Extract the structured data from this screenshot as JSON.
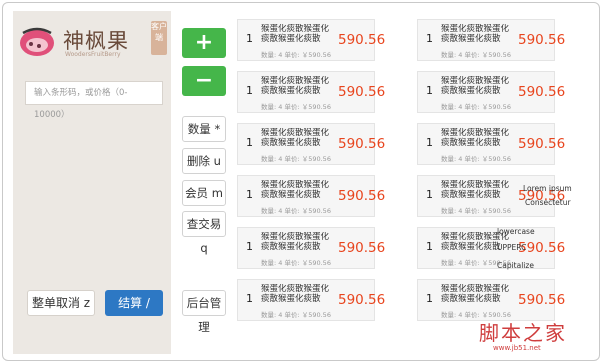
{
  "brand": {
    "name": "神枫果",
    "sub": "WoodersFruitBerry",
    "badge": "客户端"
  },
  "search": {
    "placeholder": "输入条形码，或价格（0-10000）"
  },
  "actions": {
    "plus": "+",
    "minus": "−",
    "quantity": "数量 *",
    "delete": "删除 u",
    "member": "会员 m",
    "query": "查交易 q",
    "admin": "后台管理",
    "cancel_order": "整单取消 z",
    "checkout": "结算 /"
  },
  "items": [
    {
      "qty": "1",
      "name": "猴蛋化痰散猴蛋化痰散猴蛋化痰散",
      "price": "590.56",
      "meta": "数量: 4     单价: ￥590.56"
    },
    {
      "qty": "1",
      "name": "猴蛋化痰散猴蛋化痰散猴蛋化痰散",
      "price": "590.56",
      "meta": "数量: 4     单价: ￥590.56"
    },
    {
      "qty": "1",
      "name": "猴蛋化痰散猴蛋化痰散猴蛋化痰散",
      "price": "590.56",
      "meta": "数量: 4     单价: ￥590.56"
    },
    {
      "qty": "1",
      "name": "猴蛋化痰散猴蛋化痰散猴蛋化痰散",
      "price": "590.56",
      "meta": "数量: 4     单价: ￥590.56"
    },
    {
      "qty": "1",
      "name": "猴蛋化痰散猴蛋化痰散猴蛋化痰散",
      "price": "590.56",
      "meta": "数量: 4     单价: ￥590.56"
    },
    {
      "qty": "1",
      "name": "猴蛋化痰散猴蛋化痰散猴蛋化痰散",
      "price": "590.56",
      "meta": "数量: 4     单价: ￥590.56"
    },
    {
      "qty": "1",
      "name": "猴蛋化痰散猴蛋化痰散猴蛋化痰散",
      "price": "590.56",
      "meta": "数量: 4     单价: ￥590.56"
    },
    {
      "qty": "1",
      "name": "猴蛋化痰散猴蛋化痰散猴蛋化痰散",
      "price": "590.56",
      "meta": "数量: 4     单价: ￥590.56"
    },
    {
      "qty": "1",
      "name": "猴蛋化痰散猴蛋化痰散猴蛋化痰散",
      "price": "590.56",
      "meta": "数量: 4     单价: ￥590.56"
    },
    {
      "qty": "1",
      "name": "猴蛋化痰散猴蛋化痰散猴蛋化痰散",
      "price": "590.56",
      "meta": "数量: 4     单价: ￥590.56"
    },
    {
      "qty": "1",
      "name": "猴蛋化痰散猴蛋化痰散猴蛋化痰散",
      "price": "590.56",
      "meta": "数量: 4     单价: ￥590.56"
    },
    {
      "qty": "1",
      "name": "猴蛋化痰散猴蛋化痰散猴蛋化痰散",
      "price": "590.56",
      "meta": "数量: 4     单价: ￥590.56"
    }
  ],
  "overlays": {
    "lorem": "Lorem ipsum",
    "consectetur": "Consectetur",
    "lowercase": "lowercase",
    "upperc": "UPPERC",
    "capitalize": "Capitalize"
  },
  "watermark": {
    "main": "脚本之家",
    "sub": "www.jb51.net"
  },
  "colors": {
    "green": "#45b64a",
    "blue": "#2d78c4",
    "price": "#e8451e",
    "sidebar": "#ece8e3"
  }
}
